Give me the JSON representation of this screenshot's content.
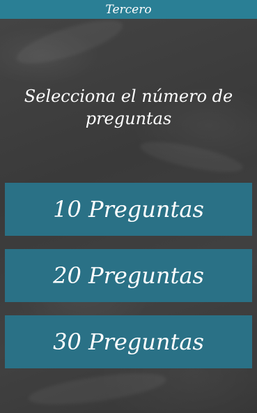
{
  "app_bar": {
    "title": "Tercero"
  },
  "main": {
    "heading": "Selecciona el número de preguntas",
    "options": [
      {
        "label": "10 Preguntas"
      },
      {
        "label": "20 Preguntas"
      },
      {
        "label": "30 Preguntas"
      }
    ]
  },
  "colors": {
    "accent": "#2a7f95",
    "button": "#2a7186",
    "background": "#3e3e3e",
    "text": "#ffffff"
  }
}
